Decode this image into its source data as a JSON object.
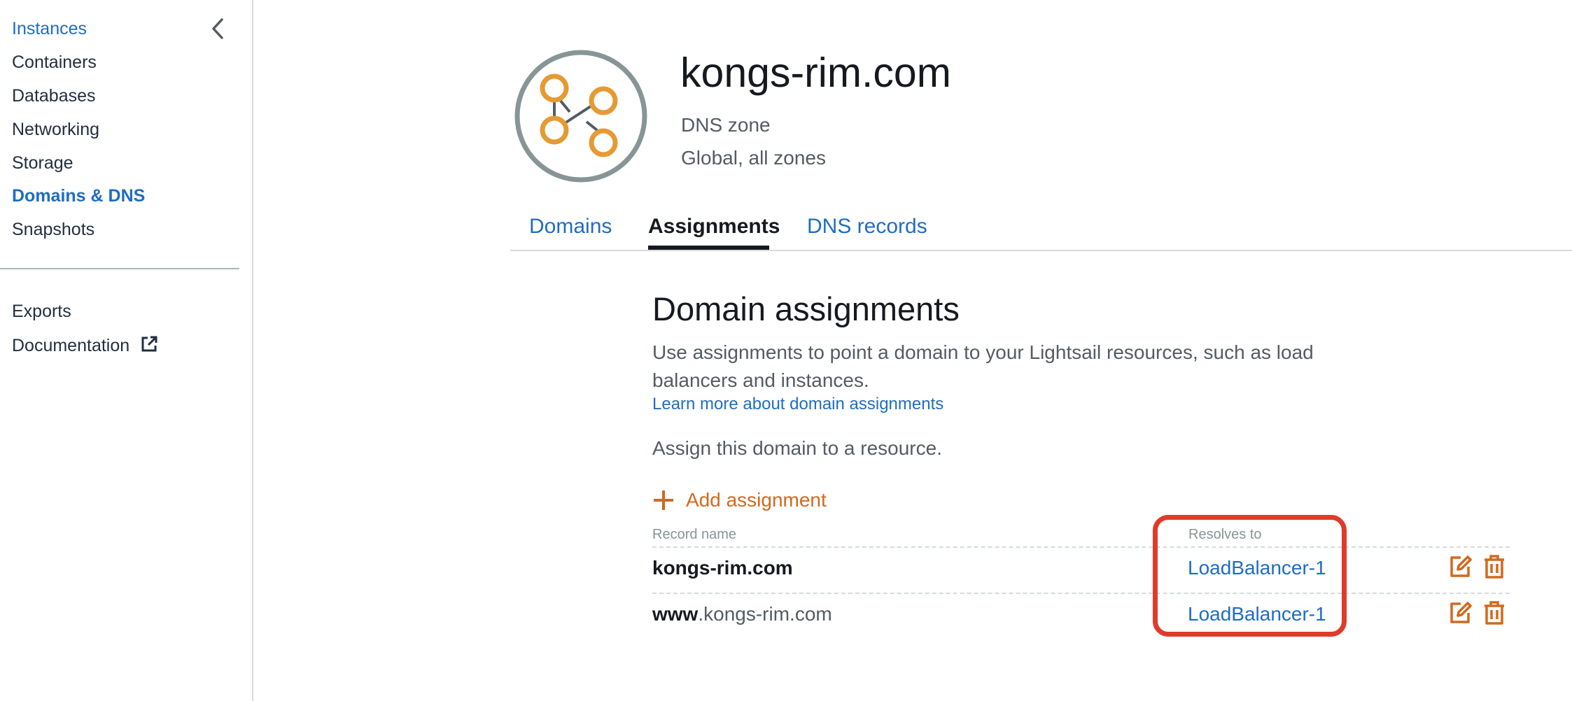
{
  "sidebar": {
    "items": [
      {
        "label": "Instances"
      },
      {
        "label": "Containers"
      },
      {
        "label": "Databases"
      },
      {
        "label": "Networking"
      },
      {
        "label": "Storage"
      },
      {
        "label": "Domains & DNS"
      },
      {
        "label": "Snapshots"
      }
    ],
    "secondary": [
      {
        "label": "Exports"
      },
      {
        "label": "Documentation"
      }
    ]
  },
  "header": {
    "title": "kongs-rim.com",
    "type": "DNS zone",
    "region": "Global, all zones"
  },
  "tabs": [
    {
      "label": "Domains"
    },
    {
      "label": "Assignments"
    },
    {
      "label": "DNS records"
    }
  ],
  "main": {
    "heading": "Domain assignments",
    "description": "Use assignments to point a domain to your Lightsail resources, such as load balancers and instances.",
    "learn_more": "Learn more about domain assignments",
    "assign_text": "Assign this domain to a resource.",
    "add_button": "Add assignment",
    "columns": {
      "record_name": "Record name",
      "resolves_to": "Resolves to"
    },
    "rows": [
      {
        "name_bold": "kongs-rim.com",
        "name_rest": "",
        "resolves_to": "LoadBalancer-1"
      },
      {
        "name_bold": "www",
        "name_rest": ".kongs-rim.com",
        "resolves_to": "LoadBalancer-1"
      }
    ]
  },
  "colors": {
    "link": "#1f6dc2",
    "accent_orange": "#d2691e",
    "logo_orange": "#e59a34",
    "highlight_red": "#e03a2b"
  },
  "icons": [
    "chevron-left-icon",
    "external-link-icon",
    "dns-zone-icon",
    "plus-icon",
    "edit-icon",
    "delete-icon"
  ]
}
